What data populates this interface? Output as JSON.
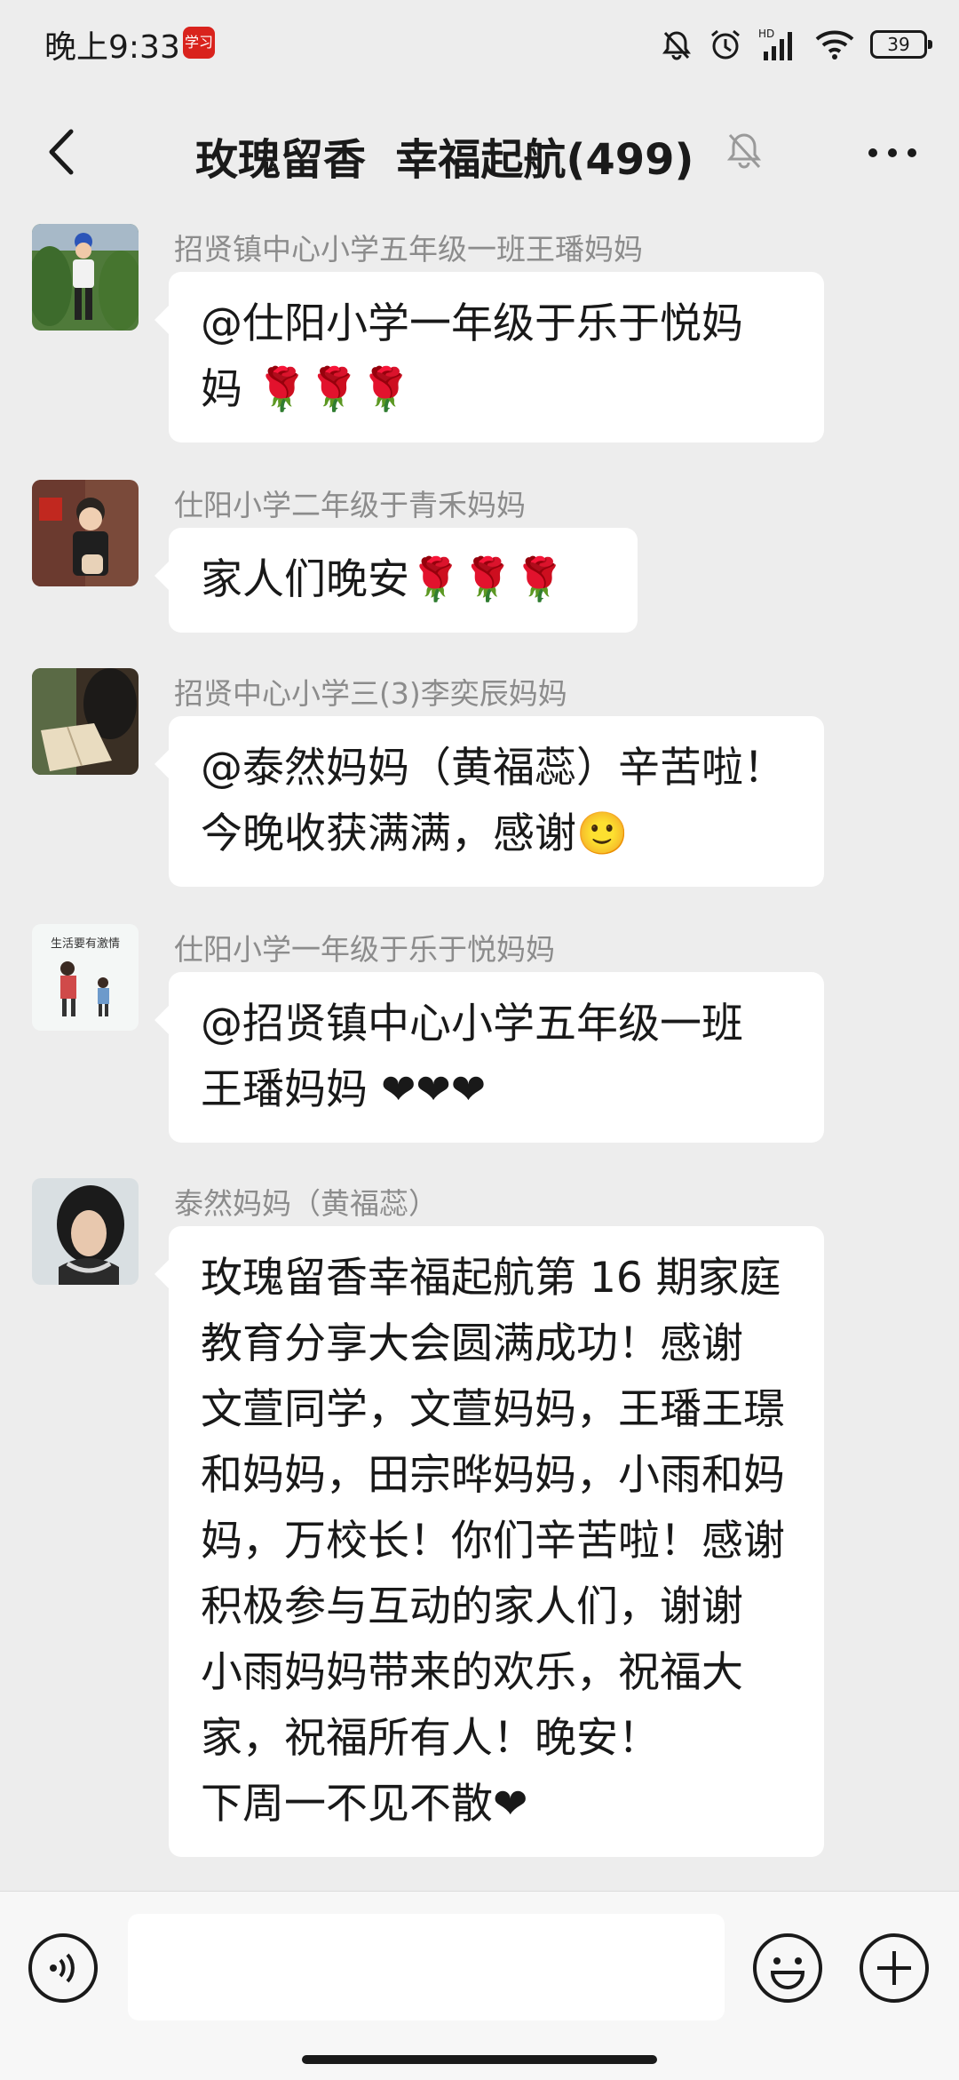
{
  "status": {
    "time": "晚上9:33",
    "app_badge": "学习",
    "battery": "39",
    "network": "HD"
  },
  "header": {
    "title": "玫瑰留香  幸福起航(499)"
  },
  "messages": [
    {
      "sender": "招贤镇中心小学五年级一班王璠妈妈",
      "lines": [
        "@仕阳小学一年级于乐于悦妈",
        "妈 🌹🌹🌹"
      ]
    },
    {
      "sender": "仕阳小学二年级于青禾妈妈",
      "lines": [
        "家人们晚安🌹🌹🌹"
      ]
    },
    {
      "sender": "招贤中心小学三(3)李奕辰妈妈",
      "lines": [
        "@泰然妈妈（黄福蕊）辛苦啦！",
        "今晚收获满满，感谢🙂"
      ]
    },
    {
      "sender": "仕阳小学一年级于乐于悦妈妈",
      "avatar_text": "生活要有激情",
      "lines": [
        "@招贤镇中心小学五年级一班",
        "王璠妈妈 ❤❤❤"
      ]
    },
    {
      "sender": "泰然妈妈（黄福蕊）",
      "lines": [
        "玫瑰留香幸福起航第 16 期家庭",
        "教育分享大会圆满成功！感谢",
        "文萱同学，文萱妈妈，王璠王璟",
        "和妈妈，田宗晔妈妈，小雨和妈",
        "妈，万校长！你们辛苦啦！感谢",
        "积极参与互动的家人们，谢谢",
        "小雨妈妈带来的欢乐，祝福大",
        "家，祝福所有人！晚安！",
        "下周一不见不散❤"
      ]
    }
  ],
  "input": {
    "placeholder": ""
  }
}
